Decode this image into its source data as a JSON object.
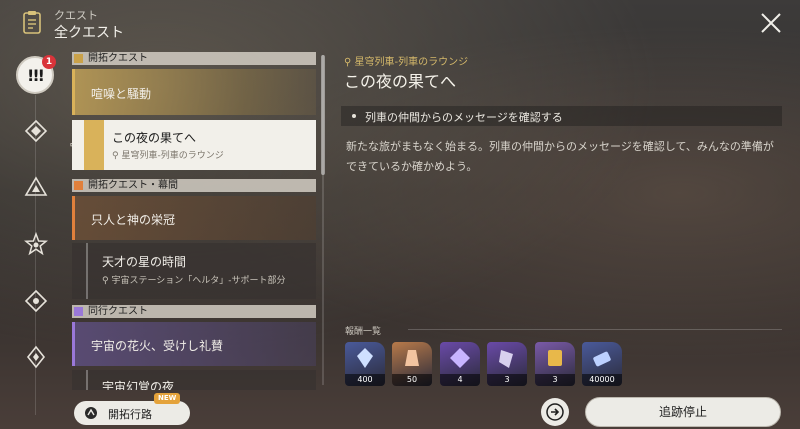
{
  "header": {
    "subtitle": "クエスト",
    "title": "全クエスト",
    "icon": "clipboard-icon",
    "close_icon": "close-icon"
  },
  "rail": {
    "badge": "1",
    "active_glyph": "!!!",
    "icons": [
      "quest-alert-icon",
      "trailblaze-diamond-icon",
      "triangle-quest-icon",
      "star-quest-icon",
      "diamond-quest-icon",
      "companion-quest-icon"
    ]
  },
  "list": {
    "sections": [
      {
        "label": "開拓クエスト"
      },
      {
        "label": "開拓クエスト・幕間"
      },
      {
        "label": "同行クエスト"
      }
    ],
    "quests": [
      {
        "title": "喧噪と騒動",
        "location": ""
      },
      {
        "title": "この夜の果てへ",
        "location": "星穹列車-列車のラウンジ"
      },
      {
        "title": "只人と神の栄冠",
        "location": ""
      },
      {
        "title": "天才の星の時間",
        "location": "宇宙ステーション「ヘルタ」-サポート部分"
      },
      {
        "title": "宇宙の花火、受けし礼賛",
        "location": ""
      },
      {
        "title": "宇宙幻覚の夜",
        "location": ""
      }
    ]
  },
  "detail": {
    "location": "星穹列車-列車のラウンジ",
    "title": "この夜の果てへ",
    "objective": "列車の仲間からのメッセージを確認する",
    "description": "新たな旅がまもなく始まる。列車の仲間からのメッセージを確認して、みんなの準備ができているか確かめよう。"
  },
  "rewards": {
    "title": "報酬一覧",
    "items": [
      {
        "icon": "stellar-jade-icon",
        "count": "400",
        "color": "#4a5a9a"
      },
      {
        "icon": "exp-crystal-icon",
        "count": "50",
        "color": "#b87a4a"
      },
      {
        "icon": "purple-material-icon",
        "count": "4",
        "color": "#6a4aa8"
      },
      {
        "icon": "purple-material-2-icon",
        "count": "3",
        "color": "#6a4aa8"
      },
      {
        "icon": "gold-book-icon",
        "count": "3",
        "color": "#7a5aa8"
      },
      {
        "icon": "credit-icon",
        "count": "40000",
        "color": "#4a5a9a"
      }
    ]
  },
  "footer": {
    "trailblaze_label": "開拓行路",
    "new_badge": "NEW",
    "stop_tracking_label": "追跡停止"
  }
}
